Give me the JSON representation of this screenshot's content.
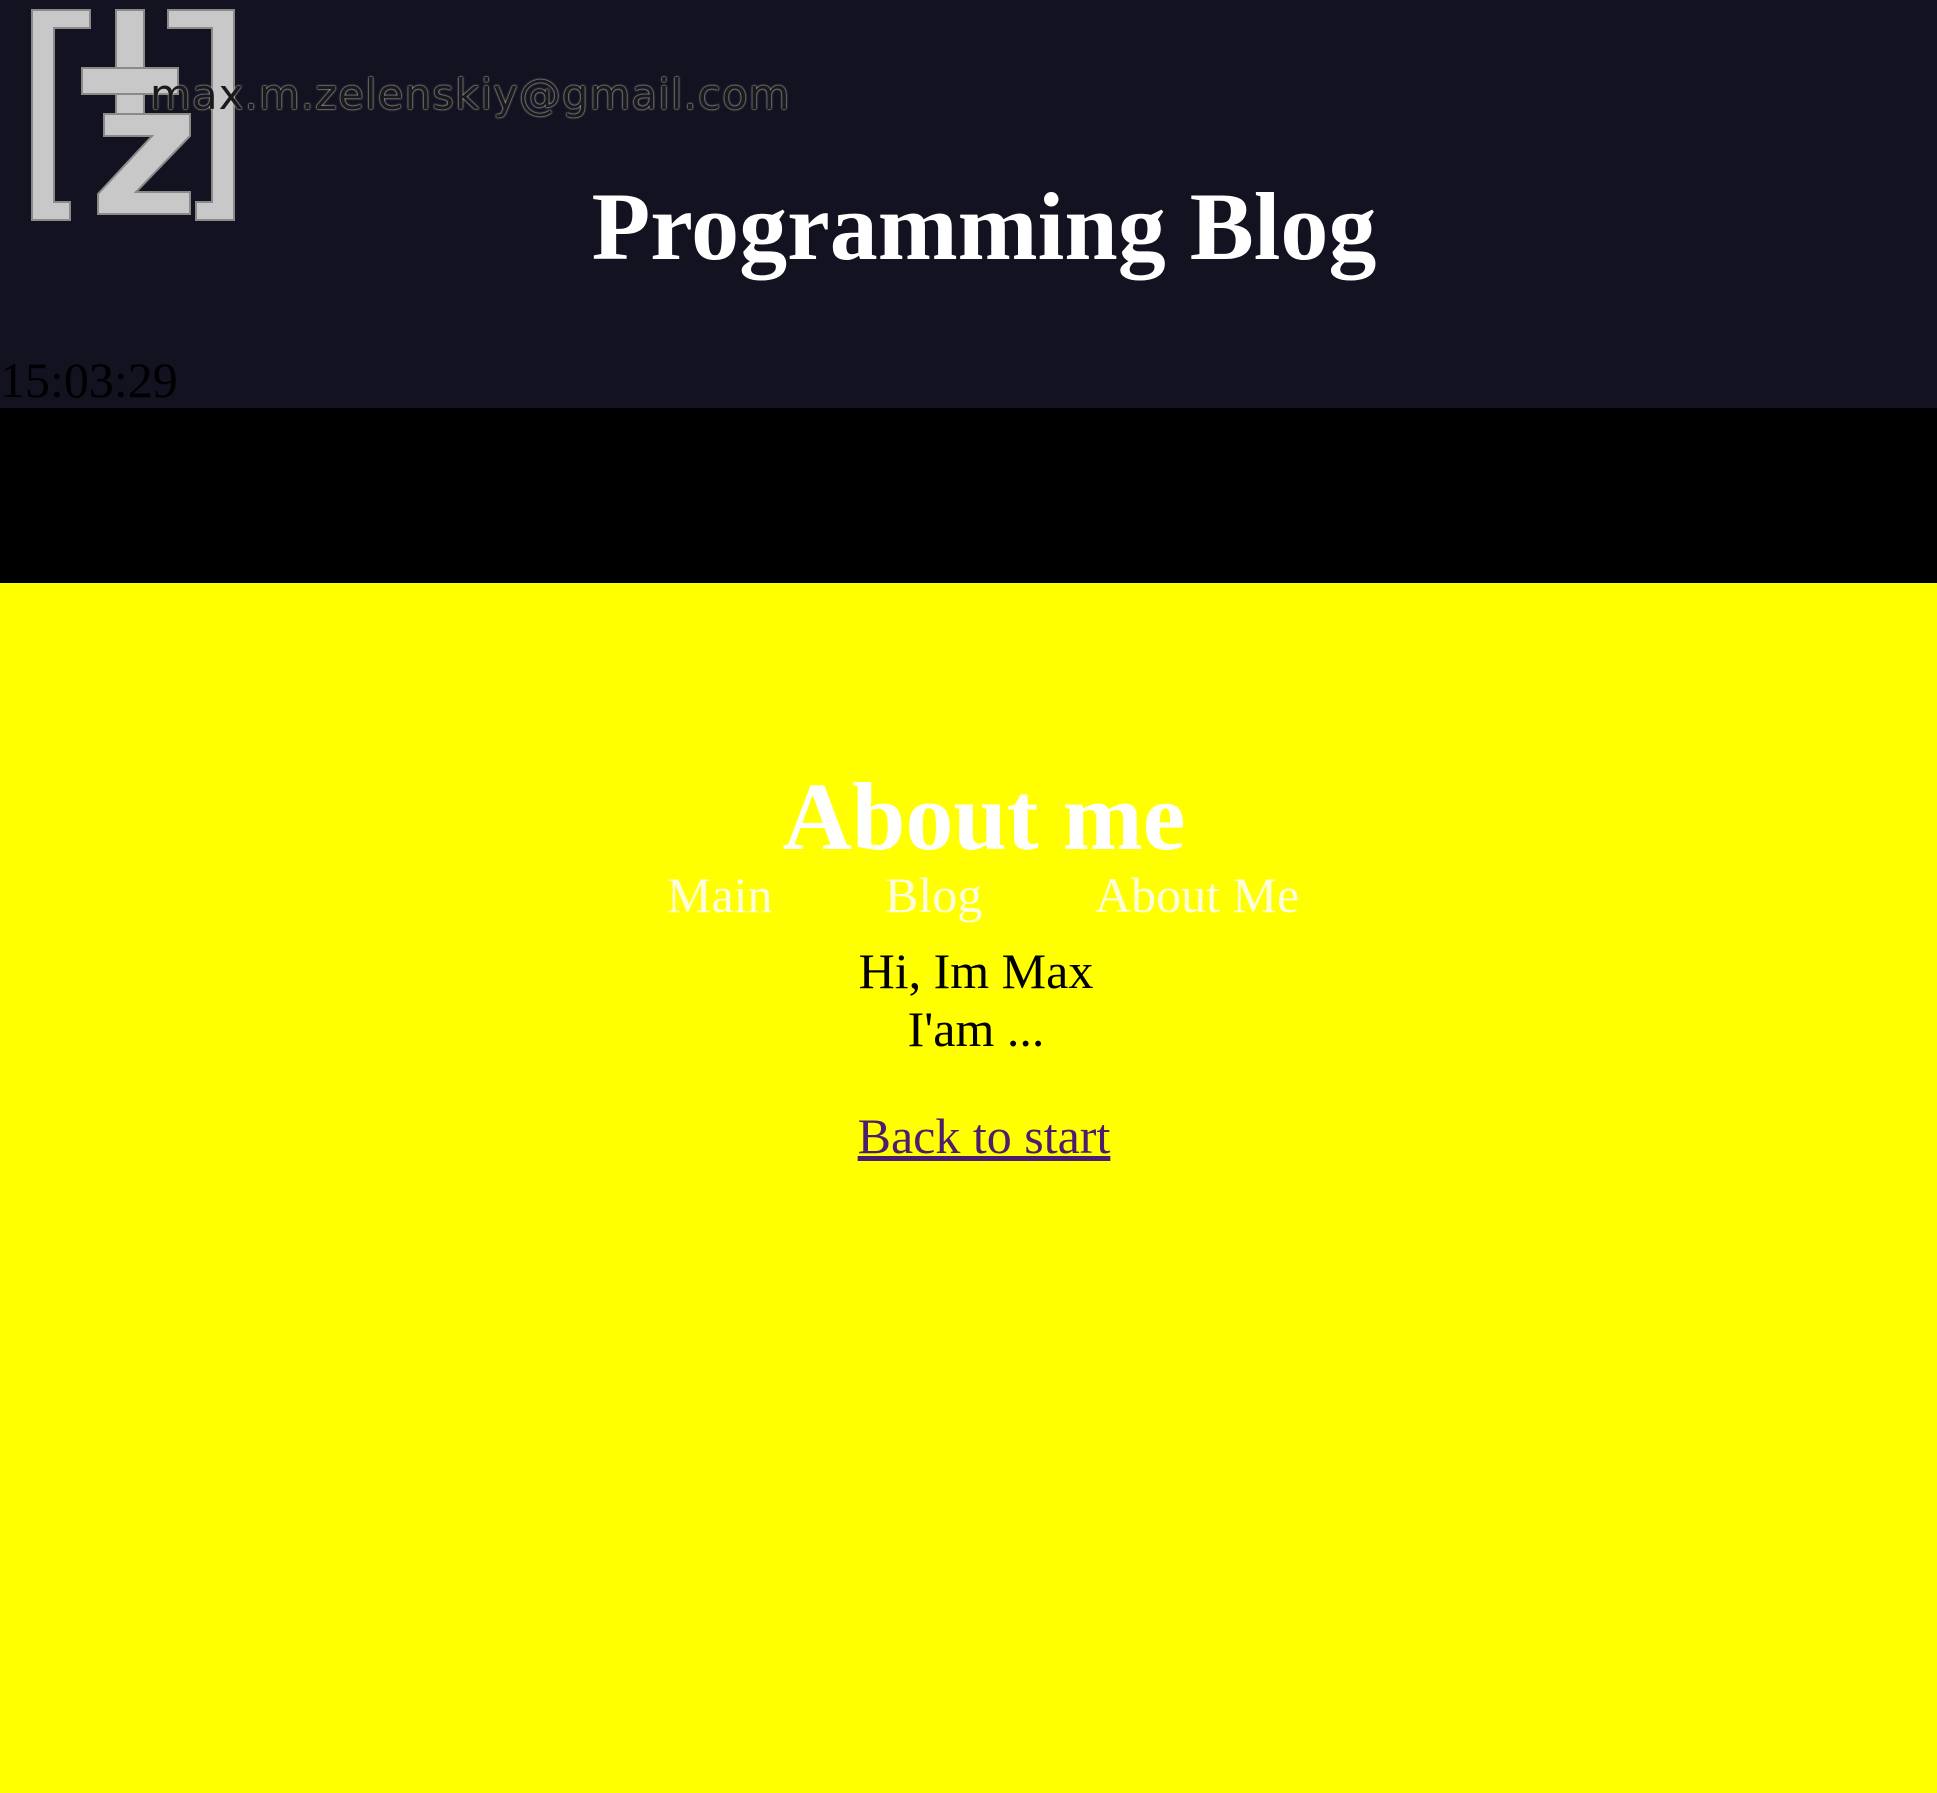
{
  "header": {
    "logo_icon": "mz-logo-icon",
    "email": "max.m.zelenskiy@gmail.com",
    "title": "Programming Blog",
    "clock": "15:03:29",
    "background_color": "#121221"
  },
  "nav": {
    "items": [
      {
        "label": "Main"
      },
      {
        "label": "Blog"
      },
      {
        "label": "About Me"
      }
    ],
    "background_color": "#000000"
  },
  "main": {
    "title": "About me",
    "intro_line1": "Hi, Im Max",
    "intro_line2": "I'am ...",
    "back_link": "Back to start",
    "background_color": "#ffff00"
  }
}
